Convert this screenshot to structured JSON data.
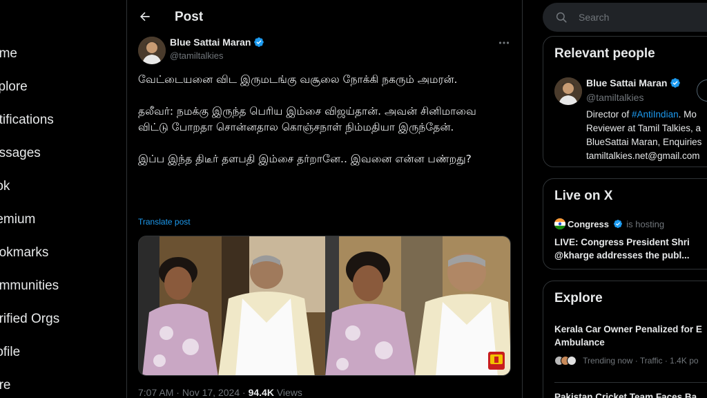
{
  "nav": {
    "items": [
      {
        "label": "ome"
      },
      {
        "label": "xplore"
      },
      {
        "label": "otifications"
      },
      {
        "label": "essages"
      },
      {
        "label": "rok"
      },
      {
        "label": "remium"
      },
      {
        "label": "ookmarks"
      },
      {
        "label": "ommunities"
      },
      {
        "label": "erified Orgs"
      },
      {
        "label": "rofile"
      },
      {
        "label": "ore"
      }
    ]
  },
  "header": {
    "title": "Post"
  },
  "post": {
    "author_name": "Blue Sattai Maran",
    "author_handle": "@tamiltalkies",
    "paragraphs": [
      "வேட்டையனை விட இருமடங்கு வசூலை நோக்கி நகரும் அமரன்.",
      "தலீவர்: நமக்கு இருந்த பெரிய இம்சை விஜய்தான். அவன் சினிமாவை விட்டு போறதா சொன்னதால கொஞ்சநாள் நிம்மதியா இருந்தேன்.",
      "இப்ப இந்த திடீர் தளபதி இம்சை தர்றானே.. இவனை என்ன பண்றது?"
    ],
    "translate_label": "Translate post",
    "time": "7:07 AM",
    "date": "Nov 17, 2024",
    "views_count": "94.4K",
    "views_label": "Views",
    "watermark": "THANTHI TV"
  },
  "search": {
    "placeholder": "Search"
  },
  "relevant_people": {
    "title": "Relevant people",
    "name": "Blue Sattai Maran",
    "handle": "@tamiltalkies",
    "bio_line1_prefix": "Director of ",
    "bio_line1_link": "#AntiIndian",
    "bio_line1_suffix": ". Mo",
    "bio_line2": "Reviewer at Tamil Talkies, a",
    "bio_line3": "BlueSattai Maran, Enquiries",
    "bio_line4": "tamiltalkies.net@gmail.com"
  },
  "live": {
    "title": "Live on X",
    "host": "Congress",
    "host_suffix": "is hosting",
    "headline": "LIVE: Congress President Shri @kharge addresses the publ..."
  },
  "explore": {
    "title": "Explore",
    "trend1_title": "Kerala Car Owner Penalized for E Ambulance",
    "trend1_meta": "Trending now · Traffic · 1.4K po",
    "trend2_title": "Pakistan Cricket Team Faces Ba"
  },
  "colors": {
    "accent": "#1d9bf0",
    "muted": "#71767b",
    "border": "#2f3336"
  }
}
